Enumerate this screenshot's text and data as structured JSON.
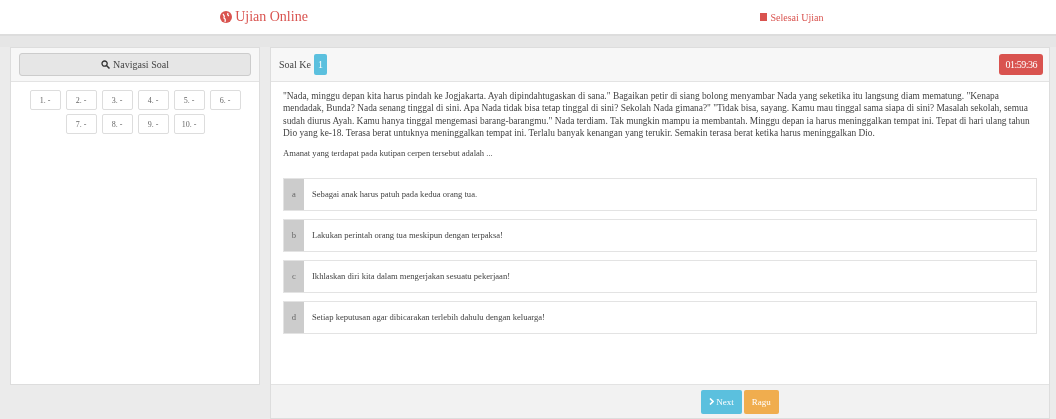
{
  "header": {
    "brand": "Ujian Online",
    "finish": "Selesai Ujian"
  },
  "navigation": {
    "title": "Navigasi Soal",
    "questions": [
      "1. -",
      "2. -",
      "3. -",
      "4. -",
      "5. -",
      "6. -",
      "7. -",
      "8. -",
      "9. -",
      "10. -"
    ]
  },
  "question": {
    "label": "Soal Ke",
    "number": "1",
    "timer": "01:59:36",
    "passage": "\"Nada, minggu depan kita harus pindah ke Jogjakarta. Ayah dipindahtugaskan di sana.\" Bagaikan petir di siang bolong menyambar Nada yang seketika itu langsung diam mematung. \"Kenapa mendadak, Bunda? Nada senang tinggal di sini. Apa Nada tidak bisa tetap tinggal di sini? Sekolah Nada gimana?\" \"Tidak bisa, sayang. Kamu mau tinggal sama siapa di sini? Masalah sekolah, semua sudah diurus Ayah. Kamu hanya tinggal mengemasi barang-barangmu.\" Nada terdiam. Tak mungkin mampu ia membantah. Minggu depan ia harus meninggalkan tempat ini. Tepat di hari ulang tahun Dio yang ke-18. Terasa berat untuknya meninggalkan tempat ini. Terlalu banyak kenangan yang terukir. Semakin terasa berat ketika harus meninggalkan Dio.",
    "prompt": "Amanat yang terdapat pada kutipan cerpen tersebut adalah ...",
    "options": [
      {
        "letter": "a",
        "text": "Sebagai anak harus patuh pada kedua orang tua.",
        "selected": false
      },
      {
        "letter": "b",
        "text": "Lakukan perintah orang tua meskipun dengan terpaksa!",
        "selected": false
      },
      {
        "letter": "c",
        "text": "Ikhlaskan diri kita dalam mengerjakan sesuatu pekerjaan!",
        "selected": false
      },
      {
        "letter": "d",
        "text": "Setiap keputusan agar dibicarakan terlebih dahulu dengan keluarga!",
        "selected": false
      }
    ]
  },
  "buttons": {
    "next": "Next",
    "doubt": "Ragu"
  }
}
